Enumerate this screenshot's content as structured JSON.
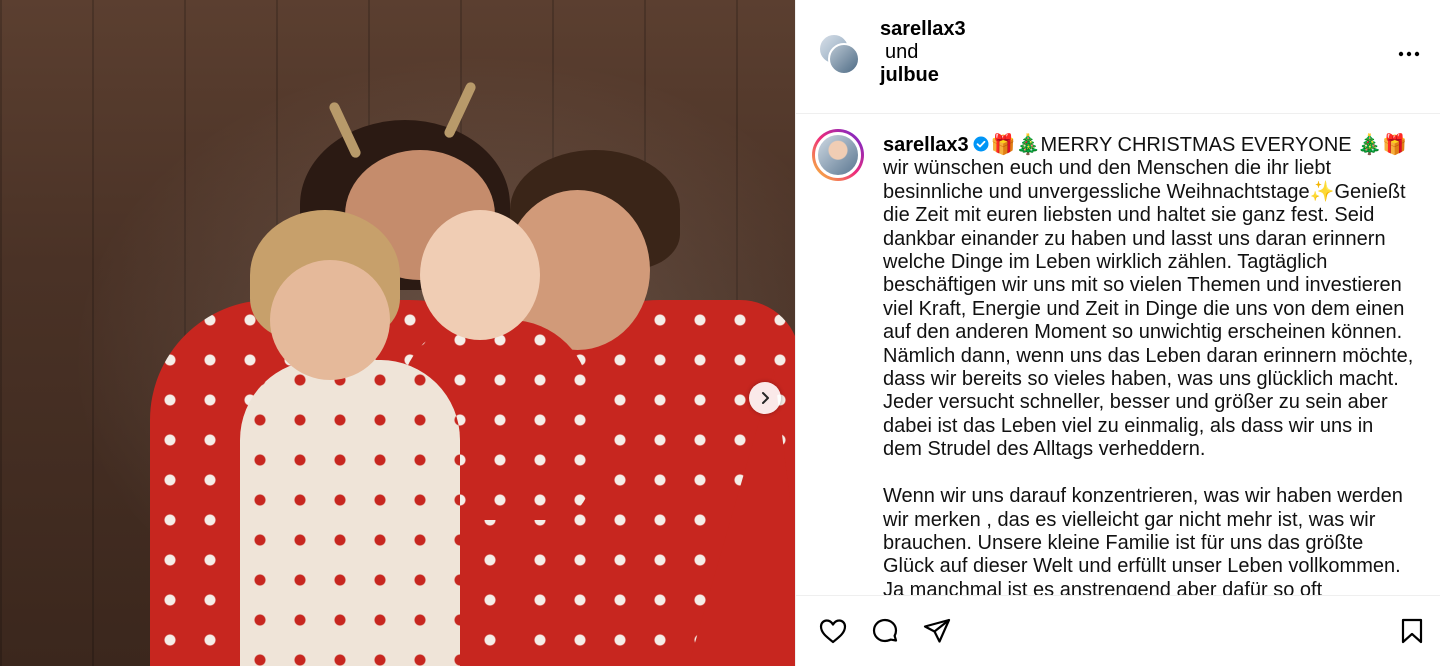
{
  "media": {
    "next_icon": "chevron-right-icon"
  },
  "header": {
    "user1": "sarellax3",
    "connector": "und",
    "user2": "julbue",
    "more_icon": "more-horizontal-icon"
  },
  "caption": {
    "username": "sarellax3",
    "verified_icon": "verified-badge-icon",
    "text": "🎁🎄MERRY CHRISTMAS EVERYONE 🎄🎁 wir wünschen euch und den Menschen die ihr liebt besinnliche und unvergessliche Weihnachtstage✨Genießt die Zeit mit euren liebsten und haltet sie ganz fest. Seid dankbar einander zu haben und lasst uns daran erinnern welche Dinge im Leben wirklich zählen. Tagtäglich beschäftigen wir uns mit so vielen Themen und investieren viel Kraft, Energie und Zeit in Dinge die uns von dem einen auf den anderen Moment so unwichtig erscheinen können.\nNämlich dann, wenn uns das Leben daran erinnern möchte, dass wir bereits so vieles haben, was uns glücklich macht. Jeder versucht schneller, besser und größer zu sein aber dabei ist das Leben viel zu einmalig, als dass wir uns in dem Strudel des Alltags verheddern.\n\nWenn wir uns darauf konzentrieren, was wir haben werden wir merken , das es vielleicht gar nicht mehr ist, was wir brauchen. Unsere kleine Familie ist für uns das größte Glück auf dieser Welt und erfüllt unser Leben vollkommen. Ja manchmal ist es anstrengend aber dafür so oft aufregend"
  },
  "actions": {
    "like_icon": "heart-icon",
    "comment_icon": "comment-icon",
    "share_icon": "paper-plane-icon",
    "save_icon": "bookmark-icon"
  },
  "colors": {
    "accent": "#0095f6",
    "border": "#efefef"
  }
}
